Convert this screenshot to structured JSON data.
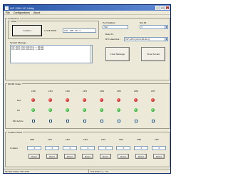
{
  "window": {
    "title": "WF-2000 I/O Utility",
    "menu": [
      "File",
      "Configurations",
      "About"
    ]
  },
  "connection": {
    "group_label": "Connection",
    "client_label": "Client",
    "connect_button": "Connect",
    "ip_prefix": "to WF-2000:",
    "ip_value": "192 . 168 . 20 . 2",
    "port_label": "Port Number",
    "port_value": "502",
    "net_id_label": "Net ID",
    "net_id_value": "3",
    "read_to_label": "Read To",
    "ip_connection_label": "IP Connection :",
    "ip_connection_value": "WF-2055 (192.168.20.2)",
    "system_message_label": "System Message",
    "log": [
      "WF-2055 (192.168.20.2) --- READ",
      "WF-2055 (192.168.20.2) --- READ"
    ],
    "clear_message_button": "Clear Message",
    "close_socket_button": "Close Socket"
  },
  "dodi": {
    "group_label": "DO/DI Status",
    "channels": [
      "CH0",
      "CH1",
      "CH2",
      "CH3",
      "CH4",
      "CH5",
      "CH6",
      "CH7"
    ],
    "row_labels": [
      "DO",
      "DI",
      "DO Active"
    ],
    "do_states": [
      "red",
      "red",
      "red",
      "red",
      "red",
      "red",
      "red",
      "red"
    ],
    "di_states": [
      "green",
      "green",
      "green",
      "green",
      "green",
      "green",
      "green",
      "green"
    ]
  },
  "counter": {
    "group_label": "Counter Status",
    "channels": [
      "CH0",
      "CH1",
      "CH2",
      "CH3",
      "CH4",
      "CH5",
      "CH6",
      "CH7"
    ],
    "row_label": "Counter",
    "values": [
      "0",
      "0",
      "0",
      "0",
      "0",
      "0",
      "0",
      "0"
    ],
    "reset_label": "Reset"
  },
  "status": {
    "module": "Module Name: WF-2055",
    "vendor": "ICP DAS Co., Ltd."
  }
}
